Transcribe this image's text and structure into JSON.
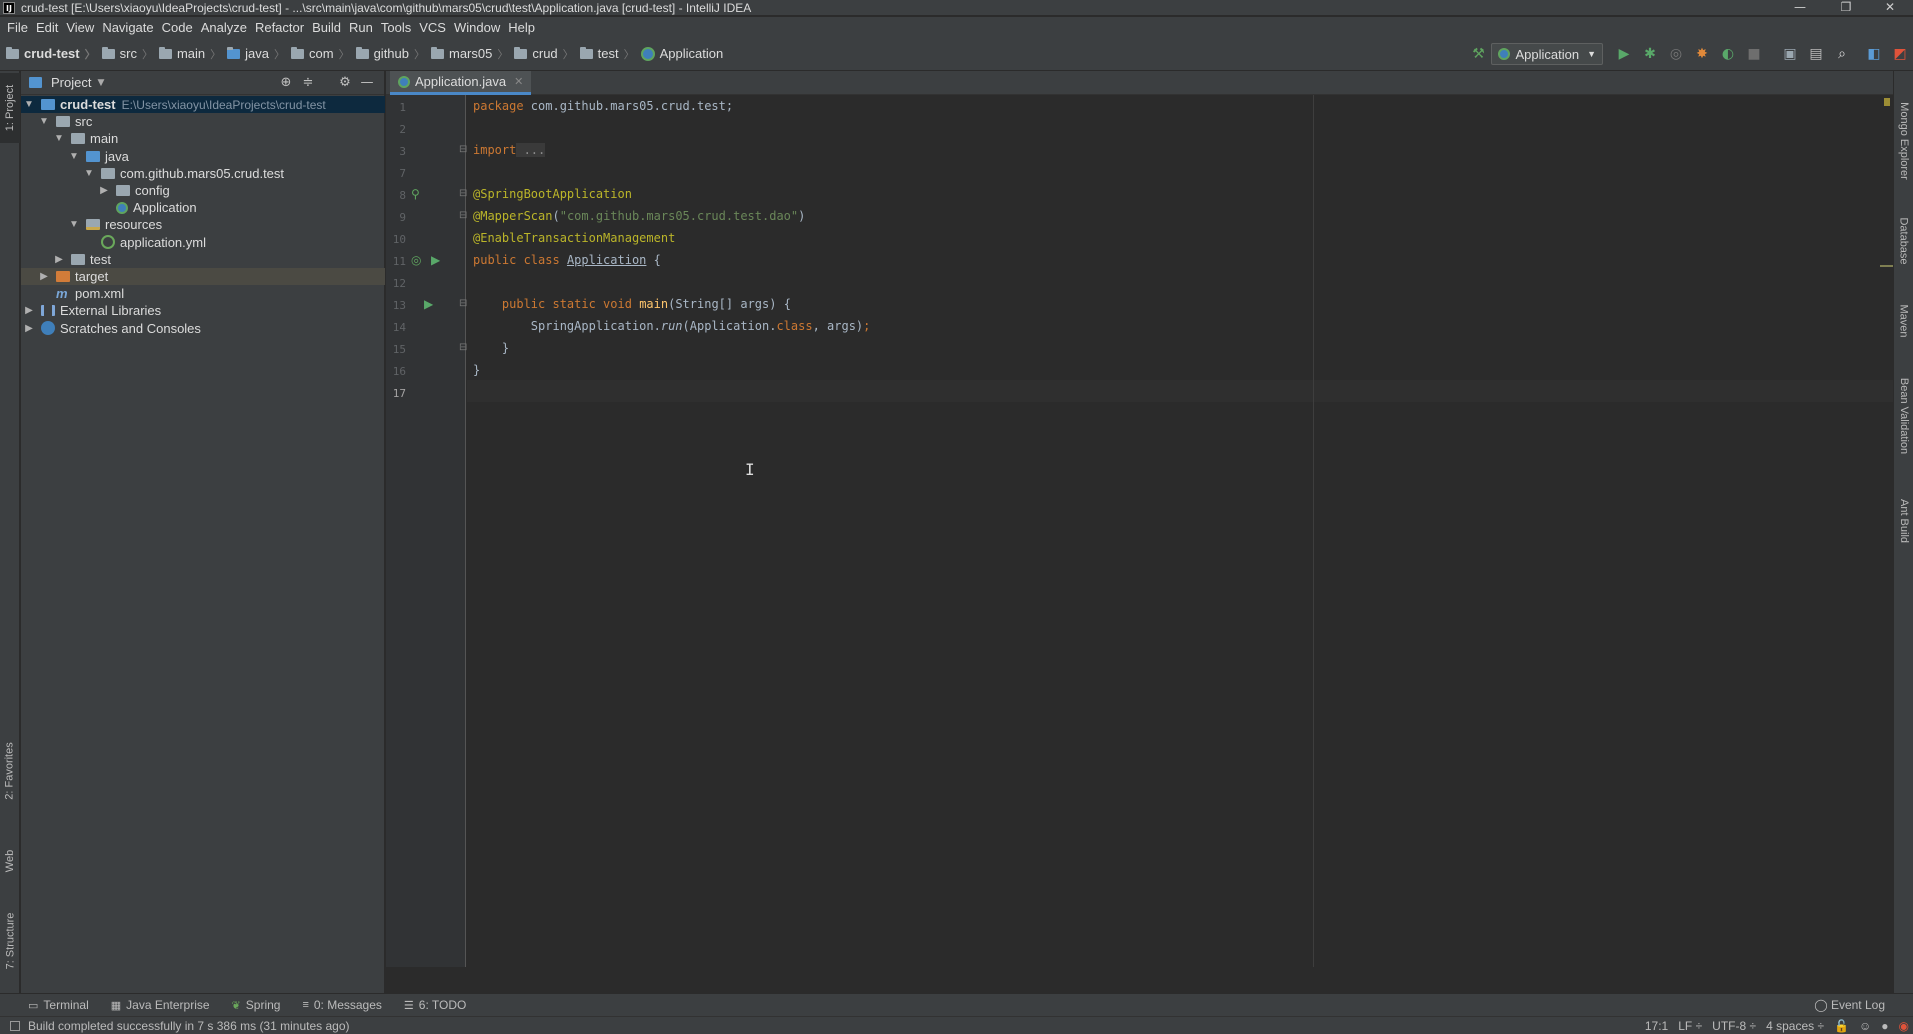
{
  "window": {
    "title": "crud-test [E:\\Users\\xiaoyu\\IdeaProjects\\crud-test] - ...\\src\\main\\java\\com\\github\\mars05\\crud\\test\\Application.java [crud-test] - IntelliJ IDEA",
    "app_icon": "IJ",
    "minimize": "—",
    "restore": "❐",
    "close": "✕"
  },
  "menu": [
    "File",
    "Edit",
    "View",
    "Navigate",
    "Code",
    "Analyze",
    "Refactor",
    "Build",
    "Run",
    "Tools",
    "VCS",
    "Window",
    "Help"
  ],
  "breadcrumbs": [
    "crud-test",
    "src",
    "main",
    "java",
    "com",
    "github",
    "mars05",
    "crud",
    "test",
    "Application"
  ],
  "toolbar": {
    "run_config": "Application",
    "icons": [
      "build-hammer-icon",
      "run-icon",
      "debug-icon",
      "coverage-icon",
      "profile-icon",
      "attach-icon",
      "stop-icon",
      "project-structure-icon",
      "layout-icon",
      "search-icon",
      "translate-icon",
      "plugin-icon"
    ]
  },
  "left_stripe": {
    "project": "1: Project",
    "favorites": "2: Favorites",
    "web": "Web",
    "structure": "7: Structure"
  },
  "right_stripe": [
    "Mongo Explorer",
    "Database",
    "Maven",
    "Bean Validation",
    "Ant Build"
  ],
  "project_panel": {
    "title": "Project",
    "tree": [
      {
        "label": "crud-test",
        "extra": "E:\\Users\\xiaoyu\\IdeaProjects\\crud-test",
        "level": 0,
        "arrow": "▼",
        "icon": "module"
      },
      {
        "label": "src",
        "level": 1,
        "arrow": "▼",
        "icon": "folder-grey"
      },
      {
        "label": "main",
        "level": 2,
        "arrow": "▼",
        "icon": "folder-grey"
      },
      {
        "label": "java",
        "level": 3,
        "arrow": "▼",
        "icon": "folder-blue"
      },
      {
        "label": "com.github.mars05.crud.test",
        "level": 4,
        "arrow": "▼",
        "icon": "package"
      },
      {
        "label": "config",
        "level": 5,
        "arrow": "▶",
        "icon": "package"
      },
      {
        "label": "Application",
        "level": 5,
        "arrow": "",
        "icon": "spring-class"
      },
      {
        "label": "resources",
        "level": 3,
        "arrow": "▼",
        "icon": "folder-resources"
      },
      {
        "label": "application.yml",
        "level": 4,
        "arrow": "",
        "icon": "yml"
      },
      {
        "label": "test",
        "level": 2,
        "arrow": "▶",
        "icon": "folder-grey"
      },
      {
        "label": "target",
        "level": 1,
        "arrow": "▶",
        "icon": "folder-orange"
      },
      {
        "label": "pom.xml",
        "level": 1,
        "arrow": "",
        "icon": "pom"
      },
      {
        "label": "External Libraries",
        "level": 0,
        "arrow": "▶",
        "icon": "library"
      },
      {
        "label": "Scratches and Consoles",
        "level": 0,
        "arrow": "▶",
        "icon": "scratch"
      }
    ]
  },
  "editor": {
    "tab": "Application.java",
    "line_numbers": [
      "1",
      "2",
      "3",
      "7",
      "8",
      "9",
      "10",
      "11",
      "12",
      "13",
      "14",
      "15",
      "16",
      "17"
    ],
    "code": {
      "l1_kw": "package",
      "l1_rest": " com.github.mars05.crud.test;",
      "l3_kw": "import",
      "l3_rest": " ...",
      "l8": "@SpringBootApplication",
      "l9_an": "@MapperScan",
      "l9_p1": "(",
      "l9_str": "\"com.github.mars05.crud.test.dao\"",
      "l9_p2": ")",
      "l10": "@EnableTransactionManagement",
      "l11_kw": "public class",
      "l11_sp": " ",
      "l11_name": "Application",
      "l11_rest": " {",
      "l13_kw": "    public static void",
      "l13_sp": " ",
      "l13_name": "main",
      "l13_rest": "(String[] args) {",
      "l14_a": "        SpringApplication.",
      "l14_run": "run",
      "l14_b": "(Application.",
      "l14_cls": "class",
      "l14_c": ", args)",
      "l14_semi": ";",
      "l15": "    }",
      "l16": "}"
    }
  },
  "bottom_tabs": [
    "Terminal",
    "Java Enterprise",
    "Spring",
    "0: Messages",
    "6: TODO"
  ],
  "event_log": "Event Log",
  "status": {
    "message": "Build completed successfully in 7 s 386 ms (31 minutes ago)",
    "position": "17:1",
    "line_sep": "LF ÷",
    "encoding": "UTF-8 ÷",
    "indent": "4 spaces ÷"
  },
  "colors": {
    "keyword": "#cc7832",
    "annotation": "#bbb529",
    "string": "#6a8759",
    "text": "#a9b7c6",
    "background": "#2b2b2b"
  }
}
